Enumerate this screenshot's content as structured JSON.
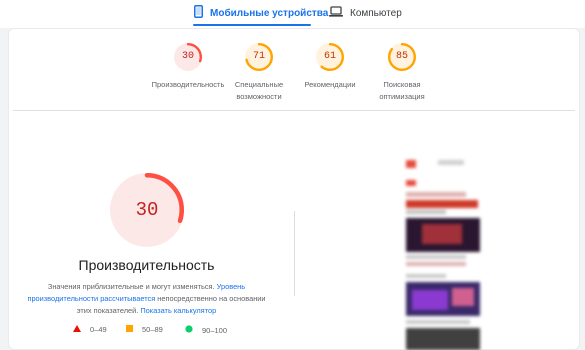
{
  "tabs": {
    "mobile_label": "Мобильные устройства",
    "desktop_label": "Компьютер"
  },
  "colors": {
    "fail": "#ff4e42",
    "average": "#ffa400",
    "pass": "#0cce6b",
    "accent": "#1a73e8"
  },
  "scores": [
    {
      "value": "30",
      "label": "Производительность",
      "status": "fail"
    },
    {
      "value": "71",
      "label": "Специальные возможности",
      "status": "average"
    },
    {
      "value": "61",
      "label": "Рекомендации",
      "status": "average"
    },
    {
      "value": "85",
      "label": "Поисковая оптимизация",
      "status": "average"
    }
  ],
  "main": {
    "score": "30",
    "title": "Производительность",
    "description_text": "Значения приблизительные и могут изменяться.",
    "description_link1": "Уровень производительности рассчитывается",
    "description_text2": "непосредственно на основании этих показателей.",
    "description_link2": "Показать калькулятор"
  },
  "legend": [
    {
      "range": "0–49",
      "icon": "triangle-icon"
    },
    {
      "range": "50–89",
      "icon": "square-icon"
    },
    {
      "range": "90–100",
      "icon": "circle-icon"
    }
  ]
}
